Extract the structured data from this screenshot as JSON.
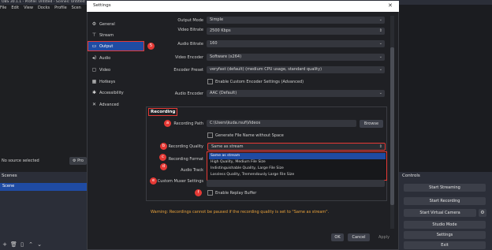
{
  "obs": {
    "title": "OBS 30.1.1 - Profile: Untitled - Scenes: Untitled",
    "menu": [
      "File",
      "Edit",
      "View",
      "Docks",
      "Profile",
      "Scen"
    ],
    "source_status": "No source selected",
    "properties_label": "Pro",
    "scenes_header": "Scenes",
    "scene_item": "Scene",
    "controls_header": "Controls",
    "controls": {
      "start_streaming": "Start Streaming",
      "start_recording": "Start Recording",
      "start_virtual_camera": "Start Virtual Camera",
      "studio_mode": "Studio Mode",
      "settings": "Settings",
      "exit": "Exit"
    }
  },
  "dialog": {
    "title": "Settings",
    "nav": [
      {
        "label": "General",
        "icon": "gear-icon"
      },
      {
        "label": "Stream",
        "icon": "antenna-icon"
      },
      {
        "label": "Output",
        "icon": "output-icon"
      },
      {
        "label": "Audio",
        "icon": "speaker-icon"
      },
      {
        "label": "Video",
        "icon": "monitor-icon"
      },
      {
        "label": "Hotkeys",
        "icon": "keyboard-icon"
      },
      {
        "label": "Accessibility",
        "icon": "accessibility-icon"
      },
      {
        "label": "Advanced",
        "icon": "wrench-icon"
      }
    ],
    "output_mode_label": "Output Mode",
    "output_mode_value": "Simple",
    "video_bitrate_label": "Video Bitrate",
    "video_bitrate_value": "2500 Kbps",
    "audio_bitrate_label": "Audio Bitrate",
    "audio_bitrate_value": "160",
    "video_encoder_label": "Video Encoder",
    "video_encoder_value": "Software (x264)",
    "encoder_preset_label": "Encoder Preset",
    "encoder_preset_value": "veryfast (default) (medium CPU usage, standard quality)",
    "custom_encoder_label": "Enable Custom Encoder Settings (Advanced)",
    "audio_encoder_label": "Audio Encoder",
    "audio_encoder_value": "AAC (Default)",
    "recording_heading": "Recording",
    "recording_path_label": "Recording Path",
    "recording_path_value": "C:\\Users\\kuda.rsuf\\Videos",
    "browse_label": "Browse",
    "gen_filename_label": "Generate File Name without Space",
    "recording_quality_label": "Recording Quality",
    "recording_quality_value": "Same as stream",
    "quality_options": [
      "Same as stream",
      "High Quality, Medium File Size",
      "Indistinguishable Quality, Large File Size",
      "Lossless Quality, Tremendously Large File Size"
    ],
    "recording_format_label": "Recording Format",
    "audio_track_label": "Audio Track",
    "custom_muxer_label": "Custom Muxer Settings",
    "replay_buffer_label": "Enable Replay Buffer",
    "warning": "Warning: Recordings cannot be paused if the recording quality is set to \"Same as stream\".",
    "ok_label": "OK",
    "cancel_label": "Cancel",
    "apply_label": "Apply"
  },
  "annotations": {
    "output_badge": "5",
    "path_badge": "a",
    "quality_badge": "b",
    "format_badge": "c",
    "audio_badge": "d",
    "muxer_badge": "e",
    "replay_badge": "f"
  },
  "colors": {
    "accent": "#1f4ba3",
    "highlight": "#e53935",
    "warning": "#e9a23b"
  }
}
